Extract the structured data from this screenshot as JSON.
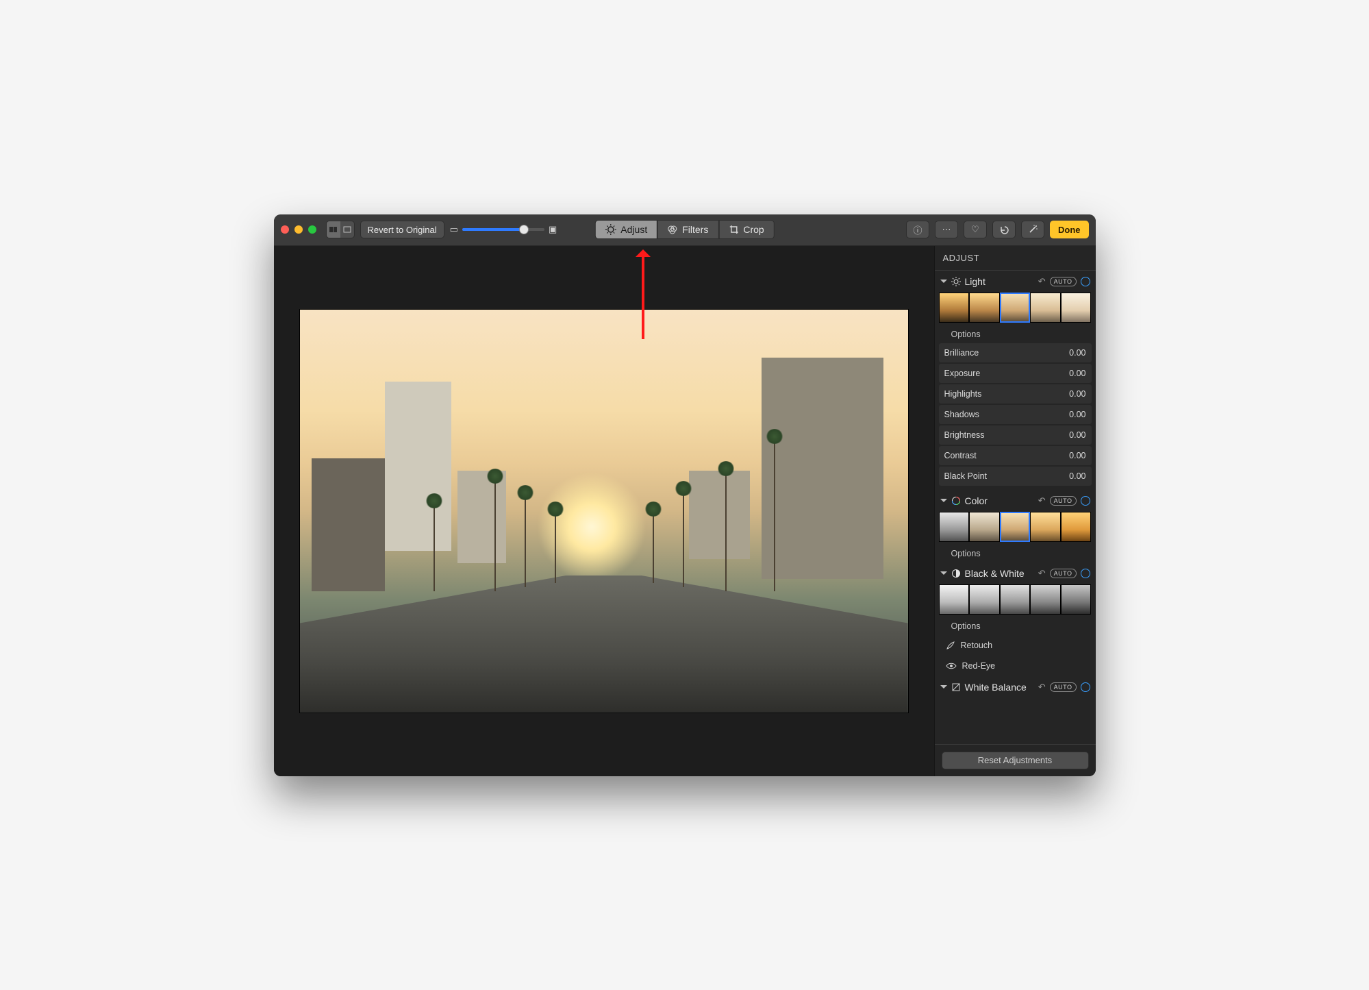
{
  "toolbar": {
    "revert_label": "Revert to Original",
    "tabs": {
      "adjust": "Adjust",
      "filters": "Filters",
      "crop": "Crop"
    },
    "done_label": "Done"
  },
  "panel": {
    "title": "ADJUST",
    "auto_label": "AUTO",
    "reset_label": "Reset Adjustments",
    "light": {
      "label": "Light",
      "options_label": "Options",
      "sliders": [
        {
          "name": "Brilliance",
          "value": "0.00"
        },
        {
          "name": "Exposure",
          "value": "0.00"
        },
        {
          "name": "Highlights",
          "value": "0.00"
        },
        {
          "name": "Shadows",
          "value": "0.00"
        },
        {
          "name": "Brightness",
          "value": "0.00"
        },
        {
          "name": "Contrast",
          "value": "0.00"
        },
        {
          "name": "Black Point",
          "value": "0.00"
        }
      ]
    },
    "color": {
      "label": "Color",
      "options_label": "Options"
    },
    "bw": {
      "label": "Black & White",
      "options_label": "Options"
    },
    "retouch": {
      "label": "Retouch"
    },
    "redeye": {
      "label": "Red-Eye"
    },
    "wb": {
      "label": "White Balance"
    }
  }
}
